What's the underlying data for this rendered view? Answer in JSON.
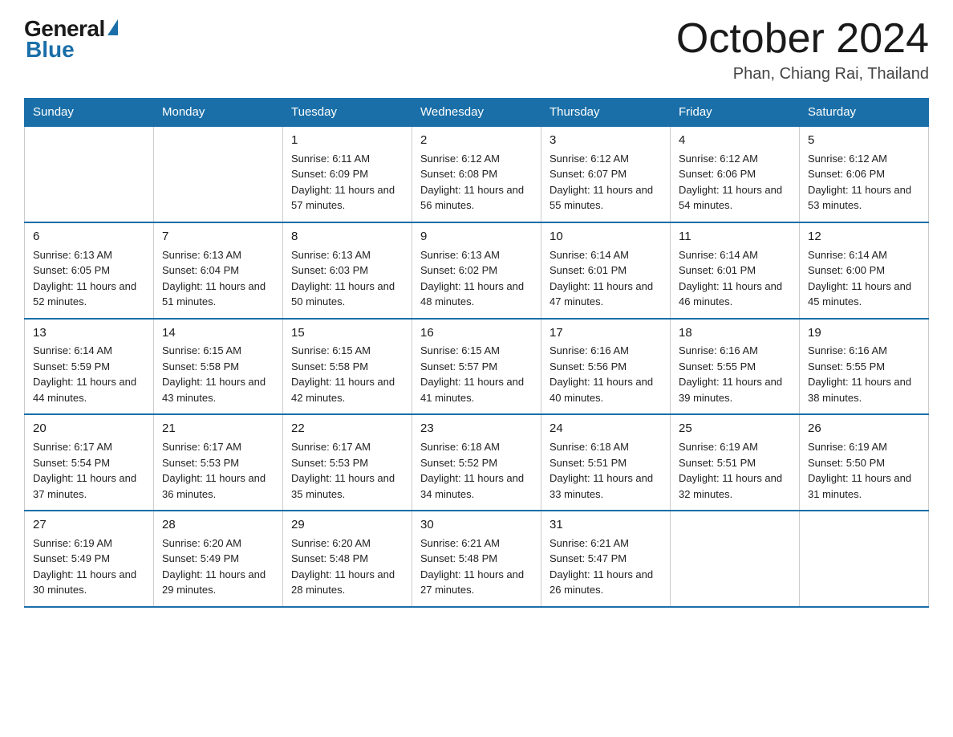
{
  "header": {
    "logo": {
      "general_text": "General",
      "blue_text": "Blue"
    },
    "title": "October 2024",
    "location": "Phan, Chiang Rai, Thailand"
  },
  "weekdays": [
    "Sunday",
    "Monday",
    "Tuesday",
    "Wednesday",
    "Thursday",
    "Friday",
    "Saturday"
  ],
  "weeks": [
    [
      {
        "day": "",
        "sunrise": "",
        "sunset": "",
        "daylight": ""
      },
      {
        "day": "",
        "sunrise": "",
        "sunset": "",
        "daylight": ""
      },
      {
        "day": "1",
        "sunrise": "Sunrise: 6:11 AM",
        "sunset": "Sunset: 6:09 PM",
        "daylight": "Daylight: 11 hours and 57 minutes."
      },
      {
        "day": "2",
        "sunrise": "Sunrise: 6:12 AM",
        "sunset": "Sunset: 6:08 PM",
        "daylight": "Daylight: 11 hours and 56 minutes."
      },
      {
        "day": "3",
        "sunrise": "Sunrise: 6:12 AM",
        "sunset": "Sunset: 6:07 PM",
        "daylight": "Daylight: 11 hours and 55 minutes."
      },
      {
        "day": "4",
        "sunrise": "Sunrise: 6:12 AM",
        "sunset": "Sunset: 6:06 PM",
        "daylight": "Daylight: 11 hours and 54 minutes."
      },
      {
        "day": "5",
        "sunrise": "Sunrise: 6:12 AM",
        "sunset": "Sunset: 6:06 PM",
        "daylight": "Daylight: 11 hours and 53 minutes."
      }
    ],
    [
      {
        "day": "6",
        "sunrise": "Sunrise: 6:13 AM",
        "sunset": "Sunset: 6:05 PM",
        "daylight": "Daylight: 11 hours and 52 minutes."
      },
      {
        "day": "7",
        "sunrise": "Sunrise: 6:13 AM",
        "sunset": "Sunset: 6:04 PM",
        "daylight": "Daylight: 11 hours and 51 minutes."
      },
      {
        "day": "8",
        "sunrise": "Sunrise: 6:13 AM",
        "sunset": "Sunset: 6:03 PM",
        "daylight": "Daylight: 11 hours and 50 minutes."
      },
      {
        "day": "9",
        "sunrise": "Sunrise: 6:13 AM",
        "sunset": "Sunset: 6:02 PM",
        "daylight": "Daylight: 11 hours and 48 minutes."
      },
      {
        "day": "10",
        "sunrise": "Sunrise: 6:14 AM",
        "sunset": "Sunset: 6:01 PM",
        "daylight": "Daylight: 11 hours and 47 minutes."
      },
      {
        "day": "11",
        "sunrise": "Sunrise: 6:14 AM",
        "sunset": "Sunset: 6:01 PM",
        "daylight": "Daylight: 11 hours and 46 minutes."
      },
      {
        "day": "12",
        "sunrise": "Sunrise: 6:14 AM",
        "sunset": "Sunset: 6:00 PM",
        "daylight": "Daylight: 11 hours and 45 minutes."
      }
    ],
    [
      {
        "day": "13",
        "sunrise": "Sunrise: 6:14 AM",
        "sunset": "Sunset: 5:59 PM",
        "daylight": "Daylight: 11 hours and 44 minutes."
      },
      {
        "day": "14",
        "sunrise": "Sunrise: 6:15 AM",
        "sunset": "Sunset: 5:58 PM",
        "daylight": "Daylight: 11 hours and 43 minutes."
      },
      {
        "day": "15",
        "sunrise": "Sunrise: 6:15 AM",
        "sunset": "Sunset: 5:58 PM",
        "daylight": "Daylight: 11 hours and 42 minutes."
      },
      {
        "day": "16",
        "sunrise": "Sunrise: 6:15 AM",
        "sunset": "Sunset: 5:57 PM",
        "daylight": "Daylight: 11 hours and 41 minutes."
      },
      {
        "day": "17",
        "sunrise": "Sunrise: 6:16 AM",
        "sunset": "Sunset: 5:56 PM",
        "daylight": "Daylight: 11 hours and 40 minutes."
      },
      {
        "day": "18",
        "sunrise": "Sunrise: 6:16 AM",
        "sunset": "Sunset: 5:55 PM",
        "daylight": "Daylight: 11 hours and 39 minutes."
      },
      {
        "day": "19",
        "sunrise": "Sunrise: 6:16 AM",
        "sunset": "Sunset: 5:55 PM",
        "daylight": "Daylight: 11 hours and 38 minutes."
      }
    ],
    [
      {
        "day": "20",
        "sunrise": "Sunrise: 6:17 AM",
        "sunset": "Sunset: 5:54 PM",
        "daylight": "Daylight: 11 hours and 37 minutes."
      },
      {
        "day": "21",
        "sunrise": "Sunrise: 6:17 AM",
        "sunset": "Sunset: 5:53 PM",
        "daylight": "Daylight: 11 hours and 36 minutes."
      },
      {
        "day": "22",
        "sunrise": "Sunrise: 6:17 AM",
        "sunset": "Sunset: 5:53 PM",
        "daylight": "Daylight: 11 hours and 35 minutes."
      },
      {
        "day": "23",
        "sunrise": "Sunrise: 6:18 AM",
        "sunset": "Sunset: 5:52 PM",
        "daylight": "Daylight: 11 hours and 34 minutes."
      },
      {
        "day": "24",
        "sunrise": "Sunrise: 6:18 AM",
        "sunset": "Sunset: 5:51 PM",
        "daylight": "Daylight: 11 hours and 33 minutes."
      },
      {
        "day": "25",
        "sunrise": "Sunrise: 6:19 AM",
        "sunset": "Sunset: 5:51 PM",
        "daylight": "Daylight: 11 hours and 32 minutes."
      },
      {
        "day": "26",
        "sunrise": "Sunrise: 6:19 AM",
        "sunset": "Sunset: 5:50 PM",
        "daylight": "Daylight: 11 hours and 31 minutes."
      }
    ],
    [
      {
        "day": "27",
        "sunrise": "Sunrise: 6:19 AM",
        "sunset": "Sunset: 5:49 PM",
        "daylight": "Daylight: 11 hours and 30 minutes."
      },
      {
        "day": "28",
        "sunrise": "Sunrise: 6:20 AM",
        "sunset": "Sunset: 5:49 PM",
        "daylight": "Daylight: 11 hours and 29 minutes."
      },
      {
        "day": "29",
        "sunrise": "Sunrise: 6:20 AM",
        "sunset": "Sunset: 5:48 PM",
        "daylight": "Daylight: 11 hours and 28 minutes."
      },
      {
        "day": "30",
        "sunrise": "Sunrise: 6:21 AM",
        "sunset": "Sunset: 5:48 PM",
        "daylight": "Daylight: 11 hours and 27 minutes."
      },
      {
        "day": "31",
        "sunrise": "Sunrise: 6:21 AM",
        "sunset": "Sunset: 5:47 PM",
        "daylight": "Daylight: 11 hours and 26 minutes."
      },
      {
        "day": "",
        "sunrise": "",
        "sunset": "",
        "daylight": ""
      },
      {
        "day": "",
        "sunrise": "",
        "sunset": "",
        "daylight": ""
      }
    ]
  ]
}
